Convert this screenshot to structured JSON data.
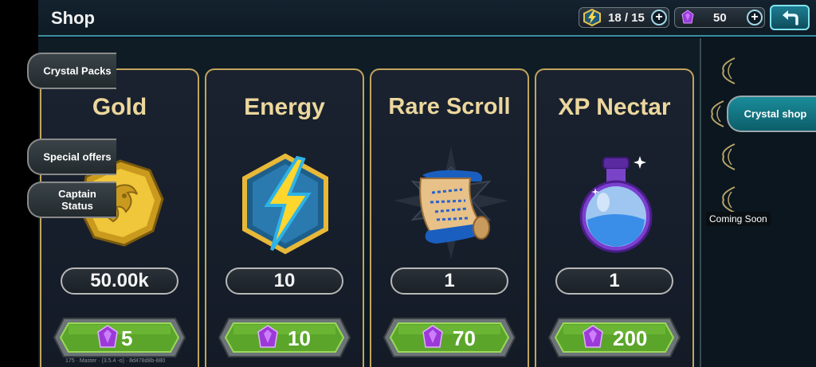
{
  "header": {
    "title": "Shop",
    "energy": "18 / 15",
    "crystals": "50"
  },
  "items": [
    {
      "name": "Gold",
      "amount": "50.00k",
      "price": "5",
      "icon": "gold-coin-icon"
    },
    {
      "name": "Energy",
      "amount": "10",
      "price": "10",
      "icon": "lightning-icon"
    },
    {
      "name": "Rare Scroll",
      "amount": "1",
      "price": "70",
      "icon": "scroll-icon"
    },
    {
      "name": "XP Nectar",
      "amount": "1",
      "price": "200",
      "icon": "potion-icon"
    }
  ],
  "sidebar": {
    "tabs": [
      {
        "label": "Crystal Packs",
        "active": false
      },
      {
        "label": "Crystal shop",
        "active": true
      },
      {
        "label": "Special offers",
        "active": false
      },
      {
        "label": "Captain Status",
        "active": false
      }
    ],
    "coming_soon": "Coming Soon"
  },
  "footer": {
    "version": "175 · Master · (3.5.4 -o) · 8d478d8b-880"
  },
  "colors": {
    "accent_teal": "#1a8c9a",
    "card_border_gold": "#c4a45a",
    "title_gold": "#ecd79c",
    "buy_green": "#5aa52a",
    "crystal_purple": "#9b3ad6"
  }
}
